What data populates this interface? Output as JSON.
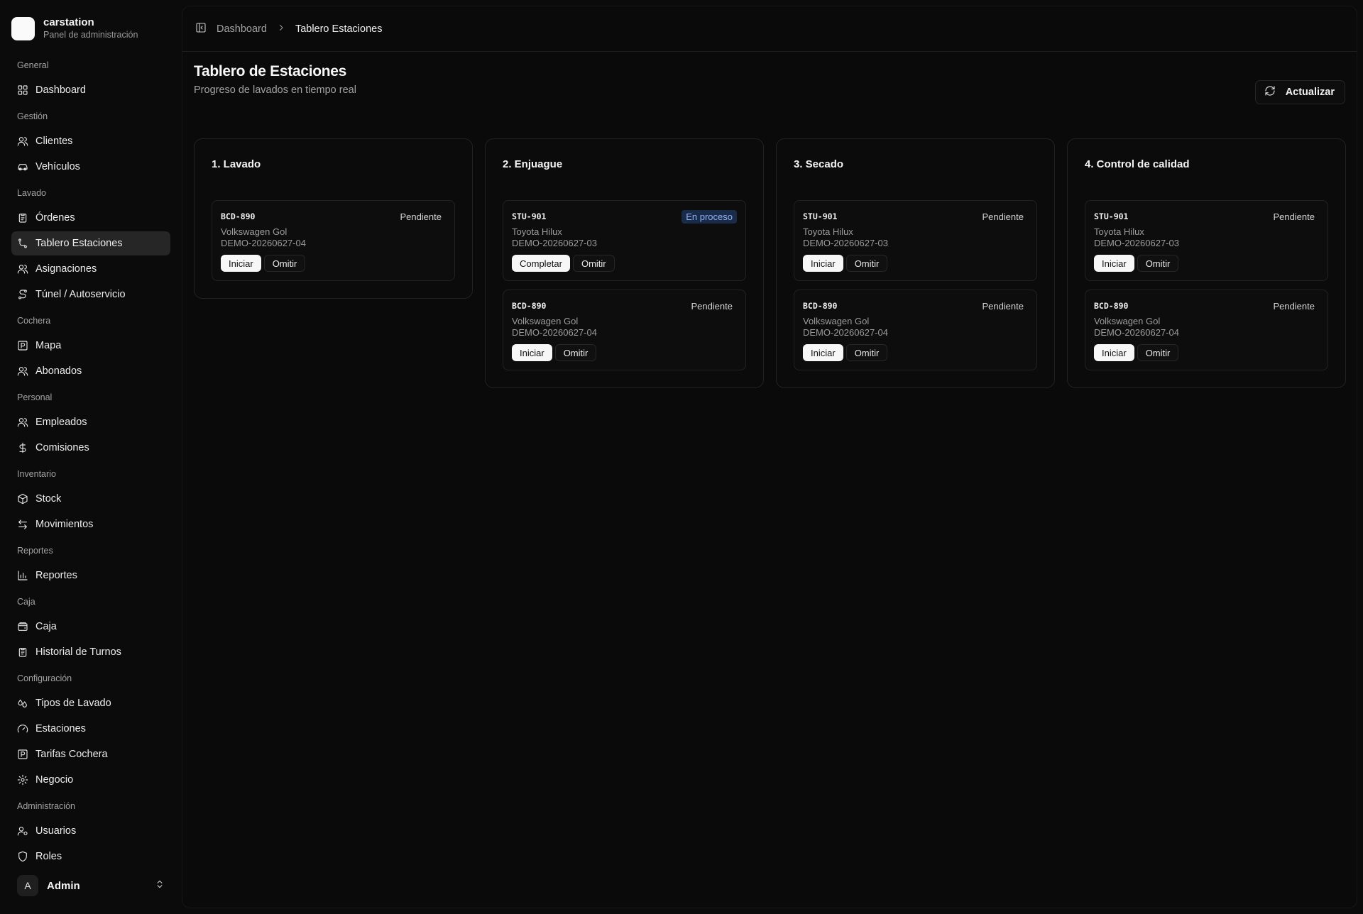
{
  "brand": {
    "name": "carstation",
    "subtitle": "Panel de administración"
  },
  "sidebar": {
    "groups": [
      {
        "label": "General",
        "items": [
          {
            "label": "Dashboard",
            "icon": "layout-grid-icon"
          }
        ]
      },
      {
        "label": "Gestión",
        "items": [
          {
            "label": "Clientes",
            "icon": "users-icon"
          },
          {
            "label": "Vehículos",
            "icon": "car-icon"
          }
        ]
      },
      {
        "label": "Lavado",
        "items": [
          {
            "label": "Órdenes",
            "icon": "clipboard-icon"
          },
          {
            "label": "Tablero Estaciones",
            "icon": "workflow-icon",
            "active": true
          },
          {
            "label": "Asignaciones",
            "icon": "users-icon"
          },
          {
            "label": "Túnel / Autoservicio",
            "icon": "route-icon"
          }
        ]
      },
      {
        "label": "Cochera",
        "items": [
          {
            "label": "Mapa",
            "icon": "parking-icon"
          },
          {
            "label": "Abonados",
            "icon": "users-icon"
          }
        ]
      },
      {
        "label": "Personal",
        "items": [
          {
            "label": "Empleados",
            "icon": "users-icon"
          },
          {
            "label": "Comisiones",
            "icon": "dollar-icon"
          }
        ]
      },
      {
        "label": "Inventario",
        "items": [
          {
            "label": "Stock",
            "icon": "package-icon"
          },
          {
            "label": "Movimientos",
            "icon": "arrows-icon"
          }
        ]
      },
      {
        "label": "Reportes",
        "items": [
          {
            "label": "Reportes",
            "icon": "bar-chart-icon"
          }
        ]
      },
      {
        "label": "Caja",
        "items": [
          {
            "label": "Caja",
            "icon": "wallet-icon"
          },
          {
            "label": "Historial de Turnos",
            "icon": "clipboard-icon"
          }
        ]
      },
      {
        "label": "Configuración",
        "items": [
          {
            "label": "Tipos de Lavado",
            "icon": "droplets-icon"
          },
          {
            "label": "Estaciones",
            "icon": "gauge-icon"
          },
          {
            "label": "Tarifas Cochera",
            "icon": "parking-icon"
          },
          {
            "label": "Negocio",
            "icon": "gear-icon"
          }
        ]
      },
      {
        "label": "Administración",
        "items": [
          {
            "label": "Usuarios",
            "icon": "user-cog-icon"
          },
          {
            "label": "Roles",
            "icon": "shield-icon"
          }
        ]
      }
    ]
  },
  "user": {
    "initial": "A",
    "name": "Admin"
  },
  "breadcrumb": {
    "parent": "Dashboard",
    "current": "Tablero Estaciones"
  },
  "page": {
    "title": "Tablero de Estaciones",
    "subtitle": "Progreso de lavados en tiempo real",
    "refresh_label": "Actualizar"
  },
  "columns": [
    {
      "title": "1. Lavado",
      "cards": [
        {
          "plate": "BCD-890",
          "status": "Pendiente",
          "vehicle": "Volkswagen Gol",
          "order": "DEMO-20260627-04",
          "primary_action": "Iniciar",
          "secondary_action": "Omitir"
        }
      ]
    },
    {
      "title": "2. Enjuague",
      "cards": [
        {
          "plate": "STU-901",
          "status": "En proceso",
          "in_progress": true,
          "vehicle": "Toyota Hilux",
          "order": "DEMO-20260627-03",
          "primary_action": "Completar",
          "secondary_action": "Omitir"
        },
        {
          "plate": "BCD-890",
          "status": "Pendiente",
          "vehicle": "Volkswagen Gol",
          "order": "DEMO-20260627-04",
          "primary_action": "Iniciar",
          "secondary_action": "Omitir"
        }
      ]
    },
    {
      "title": "3. Secado",
      "cards": [
        {
          "plate": "STU-901",
          "status": "Pendiente",
          "vehicle": "Toyota Hilux",
          "order": "DEMO-20260627-03",
          "primary_action": "Iniciar",
          "secondary_action": "Omitir"
        },
        {
          "plate": "BCD-890",
          "status": "Pendiente",
          "vehicle": "Volkswagen Gol",
          "order": "DEMO-20260627-04",
          "primary_action": "Iniciar",
          "secondary_action": "Omitir"
        }
      ]
    },
    {
      "title": "4. Control de calidad",
      "cards": [
        {
          "plate": "STU-901",
          "status": "Pendiente",
          "vehicle": "Toyota Hilux",
          "order": "DEMO-20260627-03",
          "primary_action": "Iniciar",
          "secondary_action": "Omitir"
        },
        {
          "plate": "BCD-890",
          "status": "Pendiente",
          "vehicle": "Volkswagen Gol",
          "order": "DEMO-20260627-04",
          "primary_action": "Iniciar",
          "secondary_action": "Omitir"
        }
      ]
    }
  ],
  "colors": {
    "background": "#0b0b0b",
    "active_item": "#262626",
    "in_progress_badge": "#1a2b4a",
    "in_progress_text": "#8fb4f2"
  }
}
